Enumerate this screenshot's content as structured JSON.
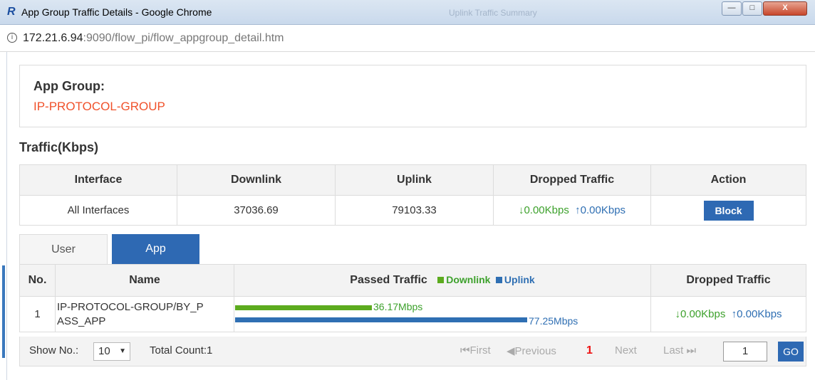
{
  "window": {
    "title": "App Group Traffic Details - Google Chrome",
    "background_tab": "Uplink Traffic Summary",
    "logo": "R",
    "min_glyph": "—",
    "max_glyph": "□",
    "close_glyph": "X"
  },
  "address": {
    "host": "172.21.6.94",
    "path": ":9090/flow_pi/flow_appgroup_detail.htm",
    "info_glyph": "i"
  },
  "group": {
    "label": "App Group:",
    "value": "IP-PROTOCOL-GROUP"
  },
  "traffic": {
    "title": "Traffic(Kbps)",
    "headers": [
      "Interface",
      "Downlink",
      "Uplink",
      "Dropped Traffic",
      "Action"
    ],
    "row": {
      "interface": "All Interfaces",
      "downlink": "37036.69",
      "uplink": "79103.33",
      "dropped_down": "↓0.00Kbps",
      "dropped_up": "↑0.00Kbps",
      "action": "Block"
    }
  },
  "tabs": [
    "User",
    "App"
  ],
  "apps": {
    "headers": {
      "no": "No.",
      "name": "Name",
      "passed": "Passed Traffic",
      "legend_down": "Downlink",
      "legend_up": "Uplink",
      "dropped": "Dropped Traffic"
    },
    "rows": [
      {
        "no": "1",
        "name": "IP-PROTOCOL-GROUP/BY_P ASS_APP",
        "down_label": "36.17Mbps",
        "up_label": "77.25Mbps",
        "down_value": 36.17,
        "up_value": 77.25,
        "dropped_down": "↓0.00Kbps",
        "dropped_up": "↑0.00Kbps"
      }
    ]
  },
  "pager": {
    "show_label": "Show No.:",
    "page_size": "10",
    "total": "Total Count:1",
    "first": "First",
    "previous": "Previous",
    "current": "1",
    "next": "Next",
    "last": "Last",
    "page_input": "1",
    "go": "GO"
  },
  "colors": {
    "accent": "#2e69b3",
    "group_value": "#f0512a",
    "downlink": "#5cab1e",
    "uplink": "#2f6fb3"
  }
}
